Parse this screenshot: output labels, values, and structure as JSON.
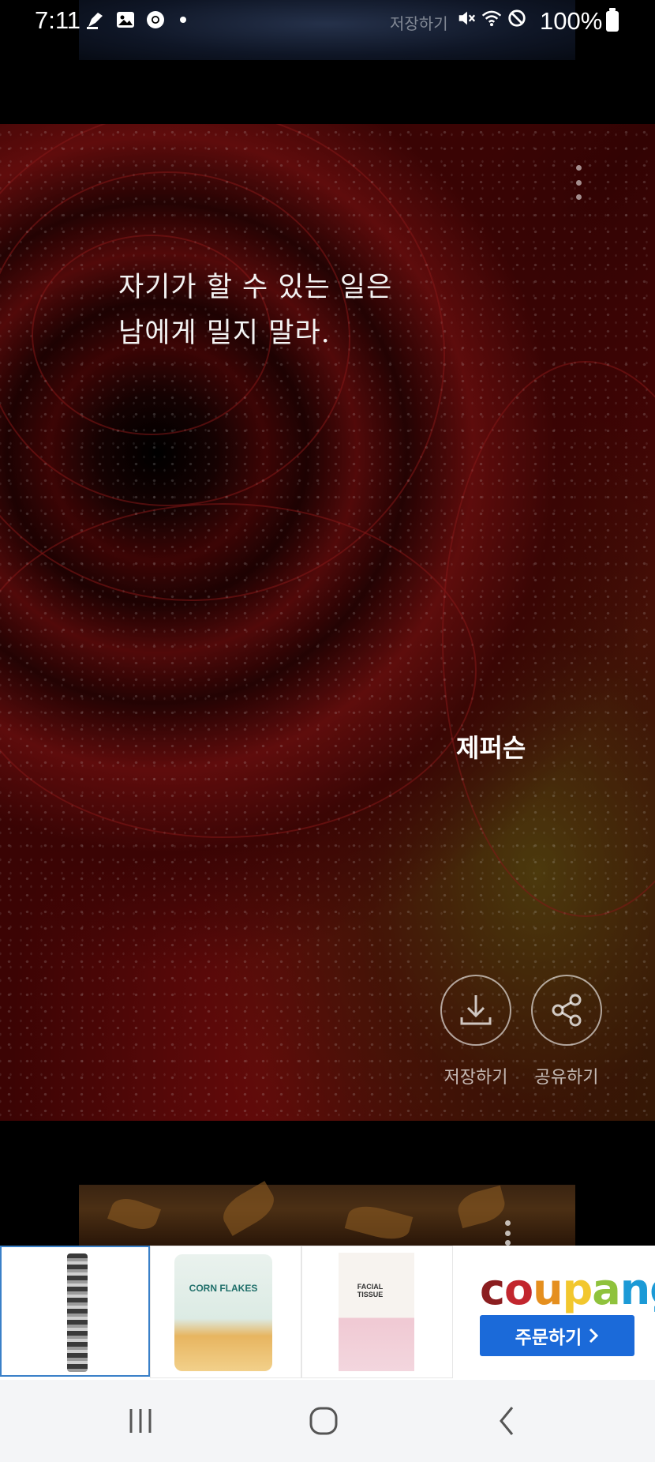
{
  "status_bar": {
    "time": "7:11",
    "battery": "100%",
    "overlay_text": "저장하기",
    "icons": [
      "pen-notification-icon",
      "gallery-icon",
      "chrome-icon",
      "dot-icon",
      "mute-icon",
      "wifi-icon",
      "do-not-disturb-icon",
      "battery-icon"
    ]
  },
  "card": {
    "quote": "자기가 할 수 있는 일은\n남에게 밀지 말라.",
    "author": "제퍼슨",
    "actions": {
      "save_label": "저장하기",
      "share_label": "공유하기"
    }
  },
  "ad": {
    "products": [
      "product-roll-item",
      "corn-flakes",
      "facial-tissue"
    ],
    "brand": [
      "c",
      "o",
      "u",
      "p",
      "a",
      "n",
      "g"
    ],
    "brand_colors": [
      "#8b1e20",
      "#c2262e",
      "#e58f1e",
      "#f2c72e",
      "#8fc23c",
      "#1c9ad6",
      "#1c9ad6"
    ],
    "order_label": "주문하기",
    "product2_text": "CORN FLAKES",
    "product3_text": "FACIAL TISSUE"
  },
  "navbar": {
    "icons": [
      "recent-apps-icon",
      "home-icon",
      "back-icon"
    ]
  }
}
